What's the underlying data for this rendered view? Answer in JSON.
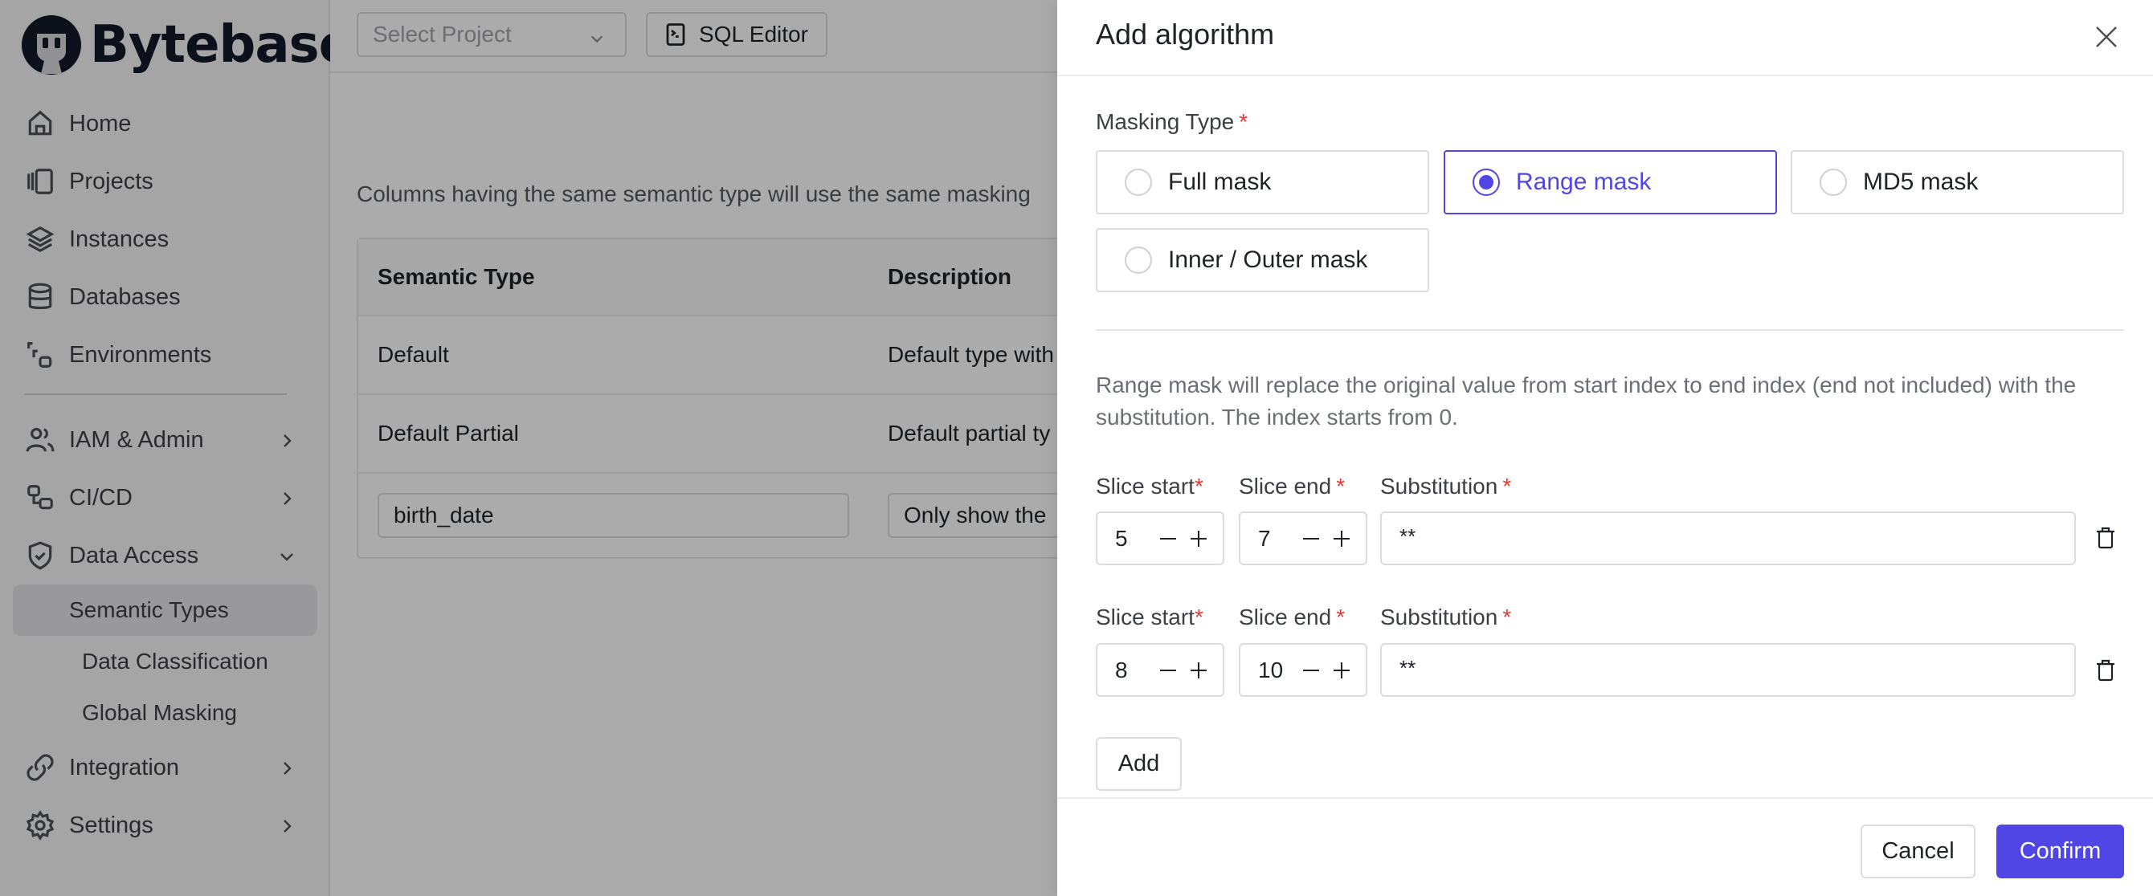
{
  "app": {
    "brand": "Bytebase",
    "topbar": {
      "project_select_placeholder": "Select Project",
      "sql_editor_label": "SQL Editor"
    },
    "sidebar": {
      "items": [
        {
          "label": "Home",
          "icon": "home-icon"
        },
        {
          "label": "Projects",
          "icon": "projects-icon"
        },
        {
          "label": "Instances",
          "icon": "layers-icon"
        },
        {
          "label": "Databases",
          "icon": "database-icon"
        },
        {
          "label": "Environments",
          "icon": "environments-icon"
        }
      ],
      "groups": [
        {
          "label": "IAM & Admin",
          "icon": "users-icon",
          "expanded": false
        },
        {
          "label": "CI/CD",
          "icon": "cicd-icon",
          "expanded": false
        },
        {
          "label": "Data Access",
          "icon": "shield-check-icon",
          "expanded": true,
          "children": [
            {
              "label": "Semantic Types",
              "active": true
            },
            {
              "label": "Data Classification",
              "active": false
            },
            {
              "label": "Global Masking",
              "active": false
            }
          ]
        },
        {
          "label": "Integration",
          "icon": "link-icon",
          "expanded": false
        },
        {
          "label": "Settings",
          "icon": "gear-icon",
          "expanded": false
        }
      ]
    },
    "main": {
      "description": "Columns having the same semantic type will use the same masking",
      "table": {
        "columns": [
          "Semantic Type",
          "Description"
        ],
        "rows": [
          {
            "semantic_type": "Default",
            "description": "Default type with"
          },
          {
            "semantic_type": "Default Partial",
            "description": "Default partial ty"
          }
        ],
        "edit_row": {
          "semantic_type": "birth_date",
          "description": "Only show the"
        }
      }
    }
  },
  "drawer": {
    "title": "Add algorithm",
    "masking_type": {
      "label": "Masking Type",
      "required_mark": "*",
      "options": [
        {
          "label": "Full mask",
          "checked": false
        },
        {
          "label": "Range mask",
          "checked": true
        },
        {
          "label": "MD5 mask",
          "checked": false
        },
        {
          "label": "Inner / Outer mask",
          "checked": false
        }
      ]
    },
    "description": "Range mask will replace the original value from start index to end index (end not included) with the substitution. The index starts from 0.",
    "slice_labels": {
      "start": "Slice start",
      "end": "Slice end",
      "substitution": "Substitution",
      "required_mark": "*"
    },
    "slices": [
      {
        "start": "5",
        "end": "7",
        "substitution": "**"
      },
      {
        "start": "8",
        "end": "10",
        "substitution": "**"
      }
    ],
    "add_label": "Add",
    "cancel_label": "Cancel",
    "confirm_label": "Confirm"
  },
  "colors": {
    "primary": "#4f46e5",
    "required": "#e53935",
    "overlay": "rgba(0,0,0,0.33)"
  }
}
